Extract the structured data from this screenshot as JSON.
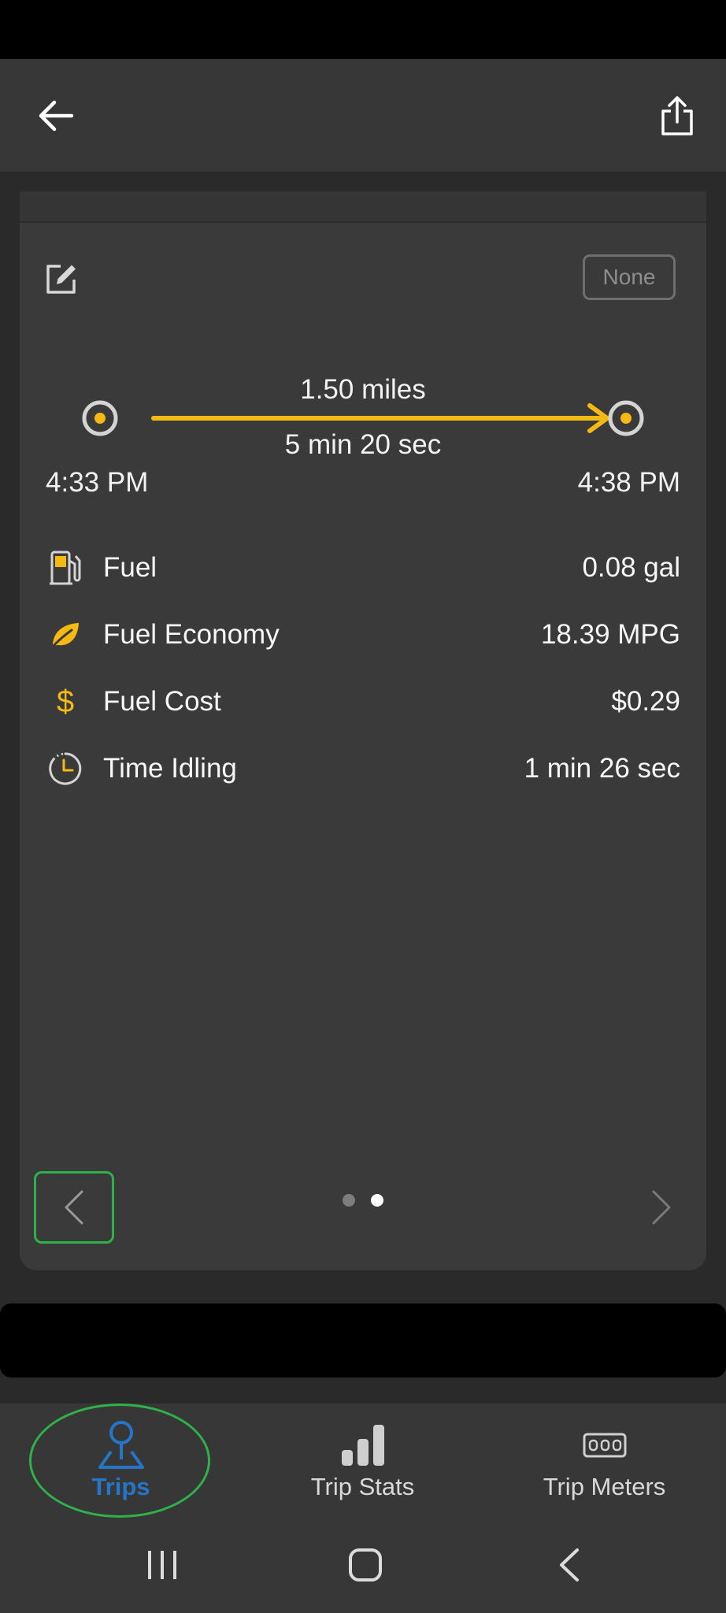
{
  "colors": {
    "accent_yellow": "#f5b914",
    "nav_active_blue": "#2476c9",
    "highlight_green": "#2fb14a",
    "background": "#2a2a2a",
    "card": "#3a3a3a"
  },
  "app_bar": {
    "back_icon": "arrow-left-icon",
    "share_icon": "share-icon"
  },
  "trip": {
    "category_label": "None",
    "distance": "1.50 miles",
    "duration": "5 min 20 sec",
    "start_time": "4:33 PM",
    "end_time": "4:38 PM",
    "stats": [
      {
        "icon": "fuel-pump-icon",
        "label": "Fuel",
        "value": "0.08 gal"
      },
      {
        "icon": "leaf-icon",
        "label": "Fuel Economy",
        "value": "18.39 MPG"
      },
      {
        "icon": "dollar-icon",
        "label": "Fuel Cost",
        "value": "$0.29"
      },
      {
        "icon": "clock-icon",
        "label": "Time Idling",
        "value": "1 min 26 sec"
      }
    ],
    "pager": {
      "pages": 2,
      "current_page": 2
    }
  },
  "bottom_nav": {
    "items": [
      {
        "label": "Trips",
        "icon": "trips-pin-icon",
        "active": true
      },
      {
        "label": "Trip Stats",
        "icon": "bar-chart-icon",
        "active": false
      },
      {
        "label": "Trip Meters",
        "icon": "odometer-icon",
        "active": false
      }
    ]
  },
  "system_nav": {
    "recents_icon": "recents-icon",
    "home_icon": "home-icon",
    "back_icon": "back-chevron-icon"
  }
}
